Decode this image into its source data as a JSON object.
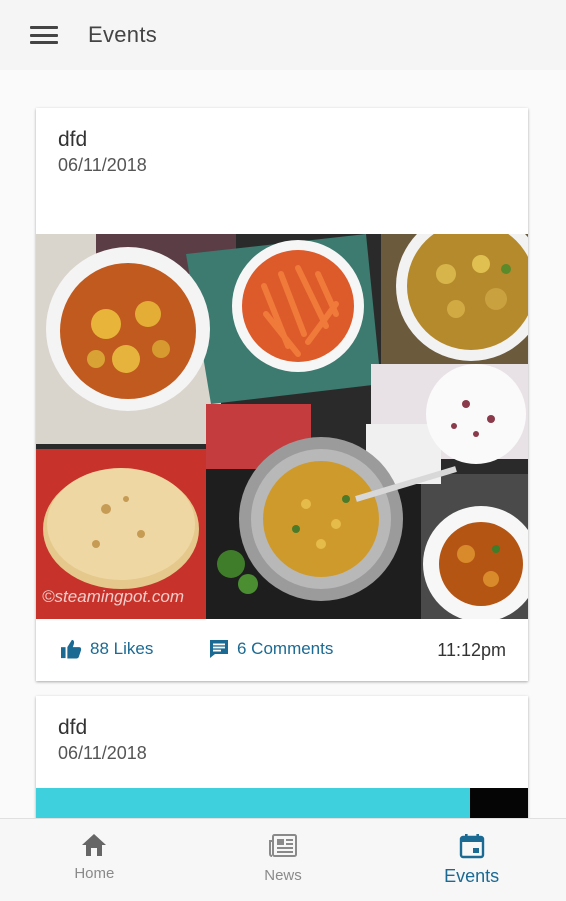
{
  "appbar": {
    "title": "Events",
    "menu_icon": "menu-icon"
  },
  "posts": [
    {
      "title": "dfd",
      "date": "06/11/2018",
      "image_watermark": "©steamingpot.com",
      "likes_label": "88 Likes",
      "comments_label": "6 Comments",
      "time": "11:12pm"
    },
    {
      "title": "dfd",
      "date": "06/11/2018"
    }
  ],
  "bottom_nav": {
    "items": [
      {
        "label": "Home",
        "icon": "home-icon",
        "active": false
      },
      {
        "label": "News",
        "icon": "newspaper-icon",
        "active": false
      },
      {
        "label": "Events",
        "icon": "calendar-icon",
        "active": true
      }
    ]
  },
  "colors": {
    "accent": "#1b6a93",
    "teal": "#3fd0dd",
    "inactive": "#8a8a8a"
  }
}
